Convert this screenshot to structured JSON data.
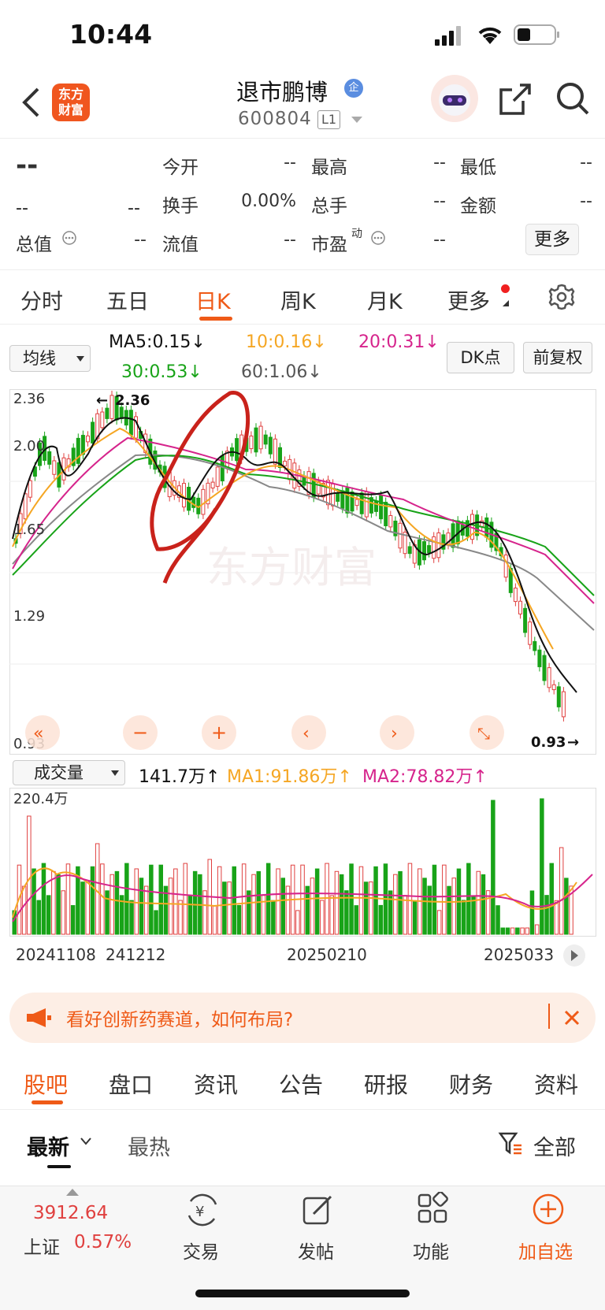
{
  "status": {
    "time": "10:44"
  },
  "header": {
    "logo_line1": "东方",
    "logo_line2": "财富",
    "title": "退市鹏博",
    "badge": "企",
    "code": "600804",
    "level": "L1"
  },
  "quote": {
    "price": "--",
    "change": "--",
    "change_pct": "--",
    "row1": [
      {
        "label": "今开",
        "value": "--"
      },
      {
        "label": "最高",
        "value": "--"
      },
      {
        "label": "最低",
        "value": "--"
      }
    ],
    "row2": [
      {
        "label": "换手",
        "value": "0.00%"
      },
      {
        "label": "总手",
        "value": "--"
      },
      {
        "label": "金额",
        "value": "--"
      }
    ],
    "row3": [
      {
        "label": "总值",
        "value": "--"
      },
      {
        "label": "流值",
        "value": "--"
      },
      {
        "label": "市盈",
        "sup": "动",
        "value": "--"
      }
    ],
    "more": "更多"
  },
  "tabs": [
    "分时",
    "五日",
    "日K",
    "周K",
    "月K",
    "更多"
  ],
  "active_tab": "日K",
  "ma_bar": {
    "selector": "均线",
    "ma5": "MA5:0.15",
    "ma10": "10:0.16",
    "ma20": "20:0.31",
    "ma30": "30:0.53",
    "ma60": "60:1.06",
    "dk": "DK点",
    "fq": "前复权",
    "arrow": "↓"
  },
  "chart_axis": {
    "y_labels": [
      "2.36",
      "2.00",
      "1.65",
      "1.29",
      "0.93"
    ],
    "high_mark": "2.36",
    "low_mark": "0.93",
    "watermark": "东方财富"
  },
  "volume_bar": {
    "selector": "成交量",
    "vol": "141.7万",
    "ma1": "MA1:91.86万",
    "ma2": "MA2:78.82万",
    "arrow": "↑",
    "max_label": "220.4万"
  },
  "dates": [
    "20241108",
    "241212",
    "20250210",
    "2025033"
  ],
  "colors": {
    "up": "#e0403f",
    "down": "#18a318",
    "ma5": "#111111",
    "ma10": "#f5a623",
    "ma20": "#d6248c",
    "ma30": "#18a318",
    "ma60": "#888888",
    "accent": "#ef5a17"
  },
  "chart_data": {
    "type": "candlestick",
    "ylim": [
      0.93,
      2.36
    ],
    "high": 2.36,
    "low": 0.93,
    "ma": {
      "MA5": 0.15,
      "MA10": 0.16,
      "MA20": 0.31,
      "MA30": 0.53,
      "MA60": 1.06
    },
    "volume": {
      "current": "141.7万",
      "MA1": "91.86万",
      "MA2": "78.82万",
      "max": "220.4万"
    }
  },
  "banner": {
    "text": "看好创新药赛道，如何布局?"
  },
  "bottom_tabs": [
    "股吧",
    "盘口",
    "资讯",
    "公告",
    "研报",
    "财务",
    "资料"
  ],
  "filters": {
    "newest": "最新",
    "hottest": "最热",
    "all": "全部"
  },
  "footer": {
    "index_value": "3912.64",
    "index_name": "上证",
    "index_pct": "0.57%",
    "trade": "交易",
    "post": "发帖",
    "func": "功能",
    "add": "加自选"
  }
}
